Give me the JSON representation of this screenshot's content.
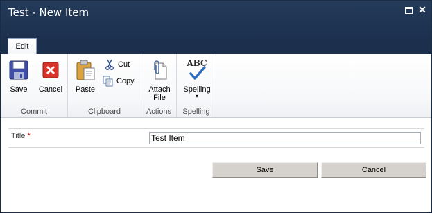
{
  "window": {
    "title": "Test - New Item",
    "close_glyph": "✕"
  },
  "tabs": [
    {
      "label": "Edit"
    }
  ],
  "ribbon": {
    "groups": [
      {
        "label": "Commit",
        "buttons": [
          {
            "label": "Save",
            "icon": "floppy-disk-icon"
          },
          {
            "label": "Cancel",
            "icon": "cancel-x-icon"
          }
        ]
      },
      {
        "label": "Clipboard",
        "buttons": [
          {
            "label": "Paste",
            "icon": "paste-icon"
          },
          {
            "label": "Cut",
            "icon": "scissors-icon"
          },
          {
            "label": "Copy",
            "icon": "copy-icon"
          }
        ]
      },
      {
        "label": "Actions",
        "buttons": [
          {
            "label_line1": "Attach",
            "label_line2": "File",
            "icon": "paperclip-icon"
          }
        ]
      },
      {
        "label": "Spelling",
        "buttons": [
          {
            "label": "Spelling",
            "icon": "spellcheck-abc-icon",
            "icon_text": "ABC",
            "dropdown_glyph": "▾"
          }
        ]
      }
    ]
  },
  "form": {
    "fields": [
      {
        "label": "Title",
        "required_marker": "*",
        "value": "Test Item"
      }
    ],
    "save_label": "Save",
    "cancel_label": "Cancel"
  },
  "colors": {
    "title_bar": "#1d3150",
    "required": "#bf0000",
    "cancel_icon": "#d9342b",
    "floppy": "#3f4fa8"
  }
}
